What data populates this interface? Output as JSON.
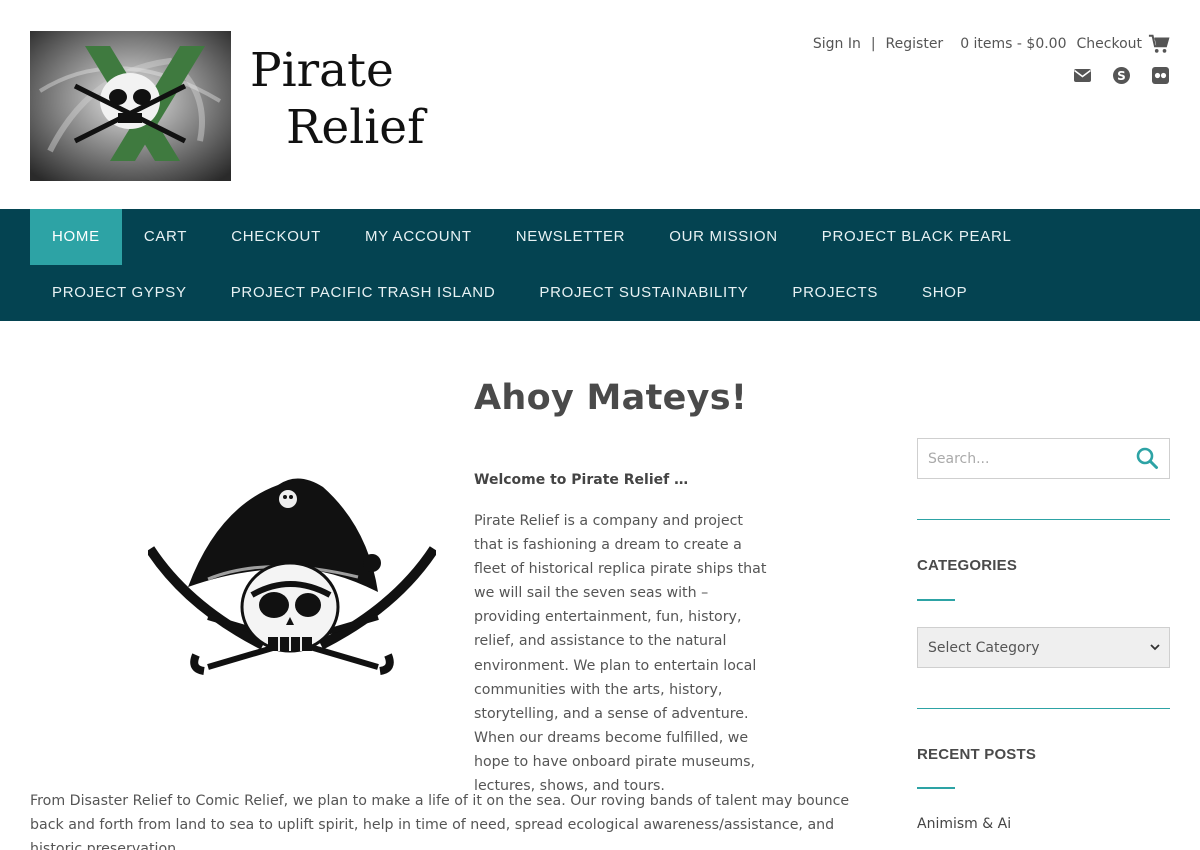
{
  "header": {
    "title_line1": "Pirate",
    "title_line2": "Relief",
    "sign_in": "Sign In",
    "separator": "|",
    "register": "Register",
    "cart_summary": "0 items - $0.00",
    "checkout": "Checkout",
    "social_icons": [
      "envelope-icon",
      "skype-icon",
      "flickr-icon"
    ]
  },
  "nav": {
    "row1": [
      "Home",
      "Cart",
      "Checkout",
      "My Account",
      "Newsletter",
      "Our Mission",
      "Project Black Pearl"
    ],
    "row2": [
      "Project Gypsy",
      "Project Pacific Trash Island",
      "Project Sustainability",
      "Projects",
      "Shop"
    ],
    "active": "Home"
  },
  "main": {
    "title": "Ahoy Mateys!",
    "welcome": "Welcome to Pirate Relief …",
    "paragraph1": "Pirate Relief is a company and project that is fashioning a dream to create a fleet of historical replica pirate ships that we will sail the seven seas with – providing entertainment, fun, history, relief, and assistance to the natural environment. We plan to entertain local communities with the arts, history, storytelling, and a sense of adventure. When our dreams become fulfilled, we hope to have onboard pirate museums, lectures, shows, and tours.",
    "paragraph2": "From Disaster Relief to Comic Relief, we plan to make a life of it on the sea. Our roving bands of talent may bounce back and forth from land to sea to uplift spirit, help in time of need, spread ecological awareness/assistance, and historic preservation."
  },
  "sidebar": {
    "search_placeholder": "Search...",
    "categories_title": "Categories",
    "category_selected": "Select Category",
    "recent_posts_title": "Recent Posts",
    "recent_posts": [
      "Animism & Ai"
    ]
  },
  "colors": {
    "nav_bg": "#044351",
    "accent": "#2da3a5",
    "text": "#555555"
  }
}
